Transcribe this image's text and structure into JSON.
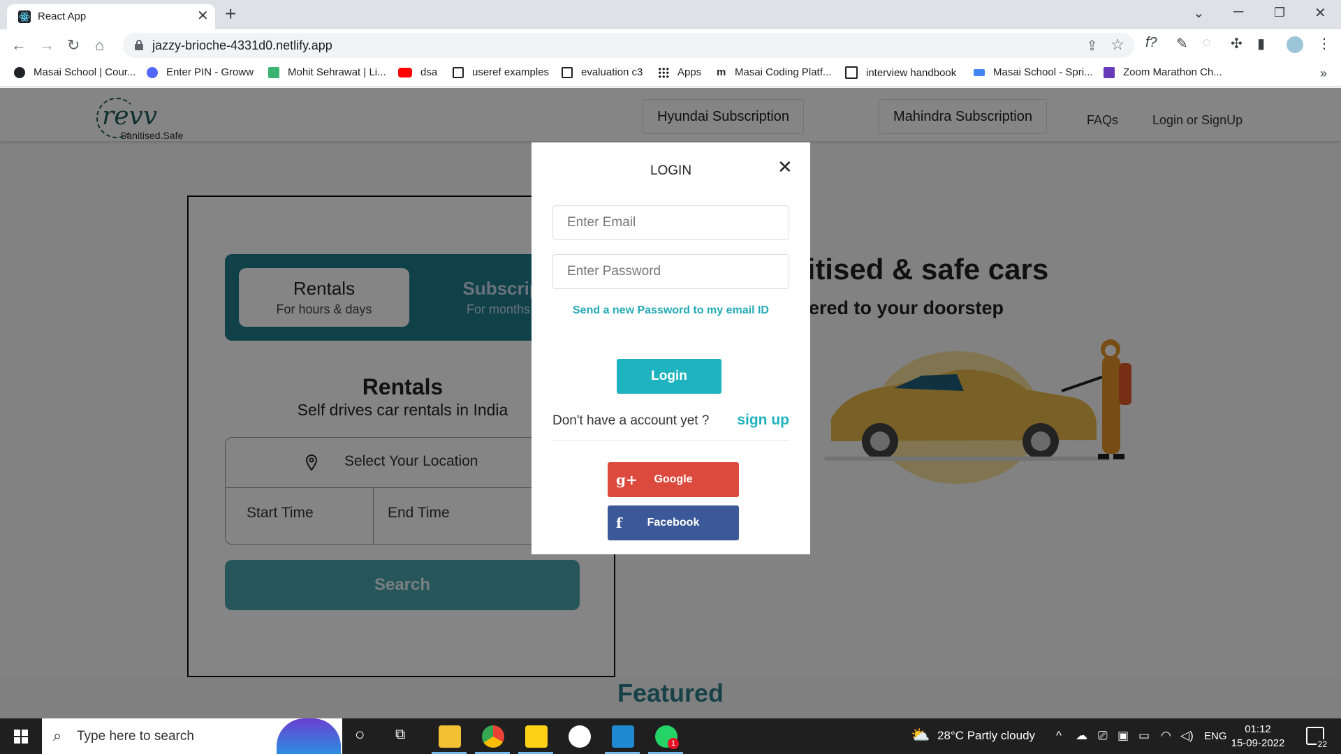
{
  "browser": {
    "tab_title": "React App",
    "tab_close": "✕",
    "new_tab": "+",
    "url": "jazzy-brioche-4331d0.netlify.app",
    "window_controls": [
      "minimize-icon",
      "restore-icon",
      "close-icon"
    ],
    "bookmarks": [
      {
        "label": "Masai School | Cour...",
        "icon": "masai-icon",
        "color": "#202124"
      },
      {
        "label": "Enter PIN - Groww",
        "icon": "groww-icon",
        "color": "#5367ff"
      },
      {
        "label": "Mohit Sehrawat | Li...",
        "icon": "linkedin-icon",
        "color": "#3cb371"
      },
      {
        "label": "dsa",
        "icon": "youtube-icon",
        "color": "#ff0000"
      },
      {
        "label": "useref examples",
        "icon": "square-icon",
        "color": "#202124"
      },
      {
        "label": "evaluation c3",
        "icon": "square-icon",
        "color": "#202124"
      },
      {
        "label": "Apps",
        "icon": "apps-grid-icon",
        "color": "#202124"
      },
      {
        "label": "Masai Coding Platf...",
        "icon": "masai-m-icon",
        "color": "#202124"
      },
      {
        "label": "interview handbook",
        "icon": "notion-icon",
        "color": "#202124"
      },
      {
        "label": "Masai School - Spri...",
        "icon": "sprint-icon",
        "color": "#4285f4"
      },
      {
        "label": "Zoom Marathon Ch...",
        "icon": "forms-icon",
        "color": "#673ab7"
      }
    ],
    "bookmarks_more": "»"
  },
  "site": {
    "logo_text": "revv",
    "logo_sub": "Sanitised.Safe",
    "nav": {
      "hyundai": "Hyundai Subscription",
      "mahindra": "Mahindra Subscription",
      "faqs": "FAQs",
      "login": "Login or SignUp"
    },
    "booking": {
      "tab_rentals_title": "Rentals",
      "tab_rentals_sub": "For hours & days",
      "tab_sub_title": "Subscriptio",
      "tab_sub_sub": "For months & ye",
      "title": "Rentals",
      "subtitle": "Self drives car rentals in India",
      "location": "Select Your Location",
      "start_time": "Start Time",
      "end_time": "End Time",
      "search": "Search"
    },
    "hero_title": "nitised & safe cars",
    "hero_sub": "ered to your doorstep",
    "featured": "Featured"
  },
  "modal": {
    "title": "LOGIN",
    "close": "✕",
    "email_placeholder": "Enter Email",
    "password_placeholder": "Enter Password",
    "reset_link": "Send a new Password to my email ID",
    "login_button": "Login",
    "no_account": "Don't have a account yet ?",
    "signup_link": "sign up",
    "google": "Google",
    "google_glyph": "g+",
    "facebook": "Facebook",
    "facebook_glyph": "f"
  },
  "colors": {
    "accent": "#1eb3bf",
    "brand_teal": "#1f7d8c",
    "google_red": "#dc4a3e",
    "facebook_blue": "#3b5998"
  },
  "taskbar": {
    "search_placeholder": "Type here to search",
    "weather": "28°C  Partly cloudy",
    "language": "ENG",
    "time": "01:12",
    "date": "15-09-2022",
    "notifications": "22",
    "whatsapp_badge": "1"
  }
}
